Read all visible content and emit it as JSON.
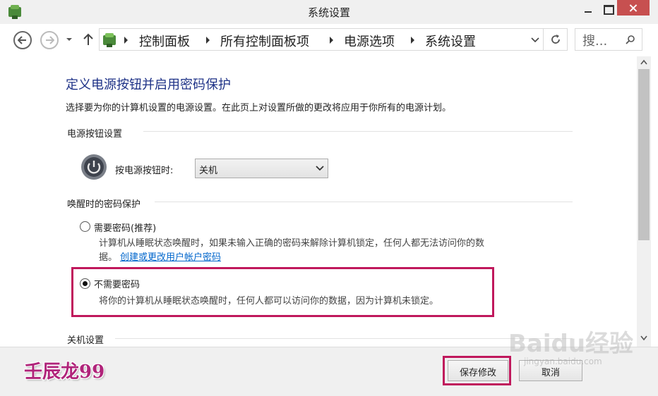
{
  "window": {
    "title": "系统设置"
  },
  "navbar": {
    "breadcrumbs": [
      "控制面板",
      "所有控制面板项",
      "电源选项",
      "系统设置"
    ],
    "search_placeholder": "搜..."
  },
  "content": {
    "heading": "定义电源按钮并启用密码保护",
    "description": "选择要为你的计算机设置的电源设置。在此页上对设置所做的更改将应用于你所有的电源计划。",
    "power_section": {
      "title": "电源按钮设置",
      "label": "按电源按钮时:",
      "selected": "关机"
    },
    "password_section": {
      "title": "唤醒时的密码保护",
      "options": [
        {
          "label": "需要密码(推荐)",
          "desc_line1": "计算机从睡眠状态唤醒时，如果未输入正确的密码来解除计算机锁定，任何人都无法访问你的数",
          "desc_line2": "据。",
          "link": "创建或更改用户帐户密码",
          "checked": false
        },
        {
          "label": "不需要密码",
          "desc_line1": "将你的计算机从睡眠状态唤醒时，任何人都可以访问你的数据，因为计算机未锁定。",
          "checked": true
        }
      ]
    },
    "shutdown_section": {
      "title": "关机设置"
    }
  },
  "footer": {
    "save_label": "保存修改",
    "cancel_label": "取消",
    "watermark": "壬辰龙99"
  },
  "overlay": {
    "baidu_text": "Baidu经验",
    "baidu_sub": "jingyan.baidu.com"
  },
  "colors": {
    "heading": "#1e3287",
    "highlight": "#c0185c",
    "link": "#0066cc",
    "close_button": "#c75050"
  }
}
